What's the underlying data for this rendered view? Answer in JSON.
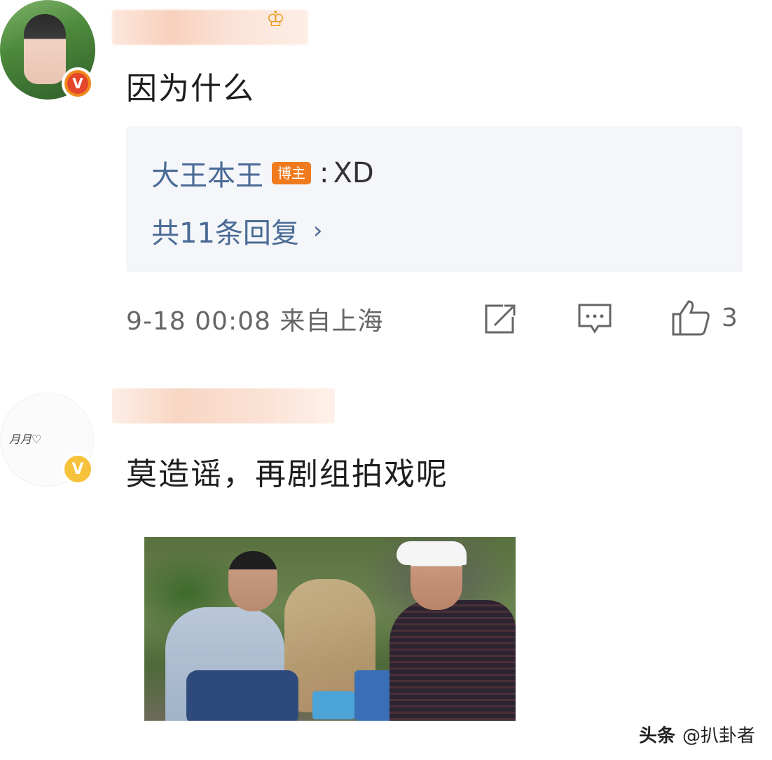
{
  "comments": [
    {
      "text": "因为什么",
      "verified": "V",
      "reply_preview": {
        "author": "大王本王",
        "tag": "博主",
        "separator": ":",
        "text": "XD",
        "count_label": "共11条回复",
        "chevron": "›"
      },
      "meta": {
        "timestamp_location": "9-18 00:08 来自上海",
        "like_count": "3"
      },
      "actions": [
        "share-icon",
        "comment-icon",
        "like-icon"
      ]
    },
    {
      "text": "莫造谣，再剧组拍戏呢",
      "verified": "V",
      "avatar_signature": "月月♡"
    }
  ],
  "watermark": {
    "brand": "头条",
    "handle": "@扒卦者"
  },
  "colors": {
    "link": "#4a6b96",
    "blogger_tag": "#f07b1e",
    "reply_bg": "#f4f6f9",
    "meta_text": "#666666"
  }
}
